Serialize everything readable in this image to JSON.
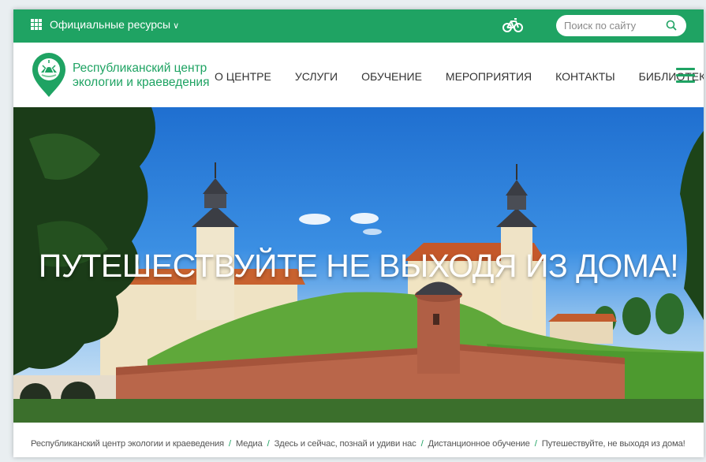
{
  "topbar": {
    "official_label": "Официальные ресурсы",
    "search_placeholder": "Поиск по сайту"
  },
  "header": {
    "brand_line1": "Республиканский центр",
    "brand_line2": "экологии и краеведения",
    "nav": [
      {
        "label": "О ЦЕНТРЕ"
      },
      {
        "label": "УСЛУГИ"
      },
      {
        "label": "ОБУЧЕНИЕ"
      },
      {
        "label": "МЕРОПРИЯТИЯ"
      },
      {
        "label": "КОНТАКТЫ"
      },
      {
        "label": "БИБЛИОТЕКА"
      }
    ]
  },
  "hero": {
    "title": "ПУТЕШЕСТВУЙТЕ НЕ ВЫХОДЯ ИЗ ДОМА!"
  },
  "breadcrumb": [
    {
      "label": "Республиканский центр экологии и краеведения"
    },
    {
      "label": "Медиа"
    },
    {
      "label": "Здесь и сейчас, познай и удиви нас"
    },
    {
      "label": "Дистанционное обучение"
    },
    {
      "label": "Путешествуйте, не выходя из дома!"
    }
  ],
  "colors": {
    "brand_green": "#1fa363",
    "sky": "#2f82dc"
  },
  "icons": [
    "grid-icon",
    "bicycle-icon",
    "search-icon",
    "logo-icon",
    "hamburger-menu-icon"
  ]
}
